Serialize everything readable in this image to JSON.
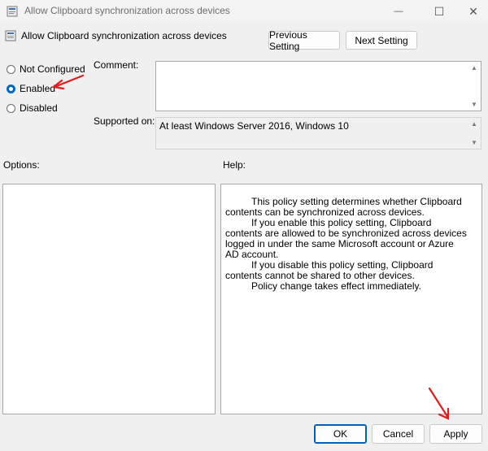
{
  "window": {
    "title": "Allow Clipboard synchronization across devices",
    "minimize_glyph": "—",
    "maximize_glyph": "☐",
    "close_glyph": "✕"
  },
  "header": {
    "policy_title": "Allow Clipboard synchronization across devices",
    "previous_label": "Previous Setting",
    "next_label": "Next Setting"
  },
  "state": {
    "options": [
      {
        "label": "Not Configured",
        "checked": false
      },
      {
        "label": "Enabled",
        "checked": true
      },
      {
        "label": "Disabled",
        "checked": false
      }
    ]
  },
  "comment": {
    "label": "Comment:",
    "value": ""
  },
  "supported": {
    "label": "Supported on:",
    "value": "At least Windows Server 2016, Windows 10"
  },
  "options_panel": {
    "label": "Options:"
  },
  "help_panel": {
    "label": "Help:",
    "paragraphs": [
      "This policy setting determines whether Clipboard contents can be synchronized across devices.",
      "If you enable this policy setting, Clipboard contents are allowed to be synchronized across devices logged in under the same Microsoft account or Azure AD account.",
      "If you disable this policy setting, Clipboard contents cannot be shared to other devices.",
      "Policy change takes effect immediately."
    ]
  },
  "footer": {
    "ok_label": "OK",
    "cancel_label": "Cancel",
    "apply_label": "Apply"
  },
  "colors": {
    "accent": "#0067c0",
    "annotation": "#e31b1b"
  }
}
